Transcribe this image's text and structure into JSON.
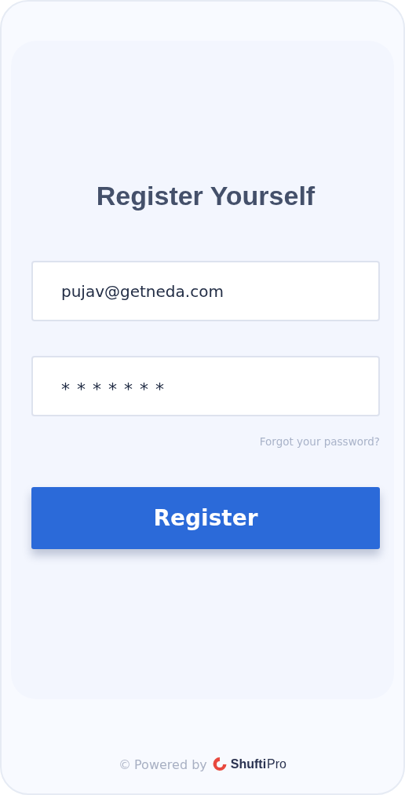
{
  "title": "Register Yourself",
  "email": {
    "value": "pujav@getneda.com"
  },
  "password": {
    "value": "*******"
  },
  "forgot_link": "Forgot your password?",
  "register_button": "Register",
  "footer": {
    "copyright": "©",
    "powered_by": "Powered by",
    "brand_bold": "Shufti",
    "brand_light": "Pro"
  }
}
